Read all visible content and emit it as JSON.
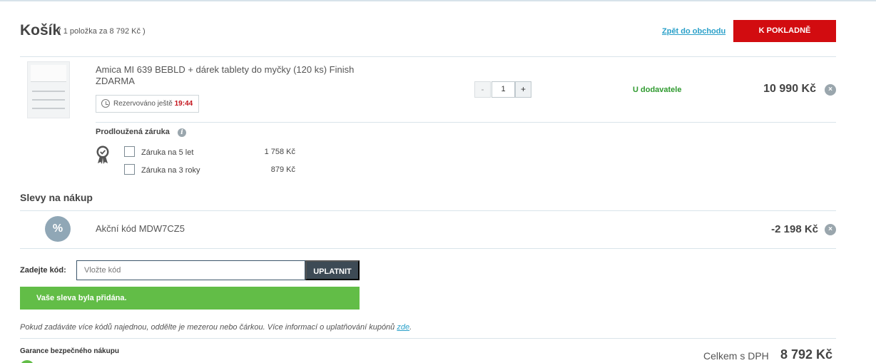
{
  "header": {
    "title": "Košík",
    "subtitle": "( 1 položka za 8 792 Kč )",
    "back_link": "Zpět do obchodu",
    "checkout_label": "K POKLADNĚ"
  },
  "item": {
    "name": "Amica MI 639 BEBLD + dárek tablety do myčky (120 ks) Finish ZDARMA",
    "reserved_label": "Rezervováno ještě",
    "reserved_time": "19:44",
    "qty_minus": "-",
    "quantity": "1",
    "qty_plus": "+",
    "availability": "U dodavatele",
    "price": "10 990 Kč",
    "remove_icon": "×"
  },
  "warranty": {
    "title": "Prodloužená záruka",
    "info_icon": "i",
    "options": [
      {
        "label": "Záruka na 5 let",
        "price": "1 758 Kč"
      },
      {
        "label": "Záruka na 3 roky",
        "price": "879 Kč"
      }
    ]
  },
  "discounts": {
    "title": "Slevy na nákup",
    "percent_icon": "%",
    "name": "Akční kód MDW7CZ5",
    "price": "-2 198 Kč",
    "remove_icon": "×"
  },
  "coupon": {
    "label": "Zadejte kód:",
    "placeholder": "Vložte kód",
    "apply_label": "UPLATNIT",
    "success_message": "Vaše sleva byla přidána.",
    "note_text": "Pokud zadáváte více kódů najednou, oddělte je mezerou nebo čárkou. Více informací o uplatňování kupónů ",
    "note_link": "zde",
    "note_end": "."
  },
  "footer": {
    "guarantee": "Garance bezpečného nákupu",
    "total_label": "Celkem s DPH",
    "total_value": "8 792 Kč"
  },
  "colors": {
    "accent_red": "#d20c10",
    "success_green": "#62bd47",
    "link_blue": "#2aa0c9",
    "availability_green": "#2f9a2f"
  }
}
